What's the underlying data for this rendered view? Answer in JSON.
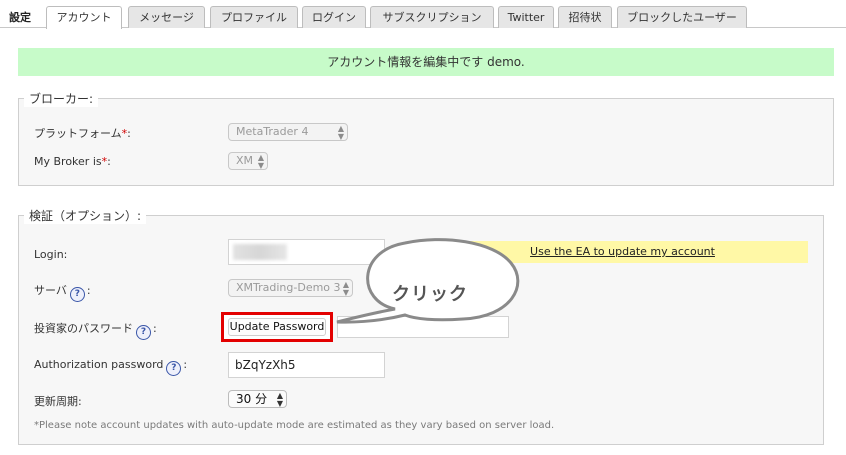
{
  "tabbar": {
    "title": "設定",
    "tabs": [
      {
        "label": "アカウント",
        "active": true
      },
      {
        "label": "メッセージ"
      },
      {
        "label": "プロファイル"
      },
      {
        "label": "ログイン"
      },
      {
        "label": "サブスクリプション"
      },
      {
        "label": "Twitter"
      },
      {
        "label": "招待状"
      },
      {
        "label": "ブロックしたユーザー"
      }
    ]
  },
  "notice": {
    "text": "アカウント情報を編集中です demo."
  },
  "broker": {
    "legend": "ブローカー:",
    "platform_label": "プラットフォーム",
    "platform_value": "MetaTrader 4",
    "broker_label": "My Broker is",
    "broker_value": "XM",
    "required_mark": "*",
    "colon": ":"
  },
  "verification": {
    "legend": "検証（オプション）:",
    "login_label": "Login:",
    "ea_link": "Use the EA to update my account",
    "server_label": "サーバ",
    "server_value": "XMTrading-Demo 3",
    "investor_label": "投資家のパスワード",
    "update_password_button": "Update Password",
    "auth_label": "Authorization password",
    "auth_value": "bZqYzXh5",
    "interval_label": "更新周期:",
    "interval_value": "30 分",
    "help_glyph": "?",
    "colon": ":",
    "footnote": "*Please note account updates with auto-update mode are estimated as they vary based on server load."
  },
  "callout": {
    "text": "クリック"
  },
  "colors": {
    "notice_bg": "#c7fbc9",
    "link_bg": "#fff8a6",
    "highlight_red": "#e30000",
    "required_red": "#d00000",
    "help_blue": "#3a56a8"
  }
}
